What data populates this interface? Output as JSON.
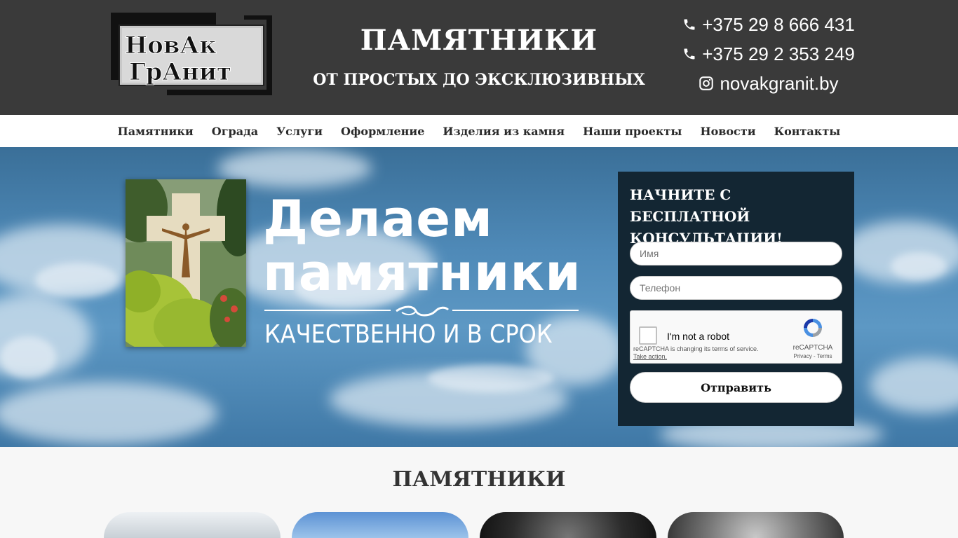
{
  "header": {
    "logo_line1": "НовАк",
    "logo_line2": "ГрАнит",
    "title": "ПАМЯТНИКИ",
    "subtitle": "ОТ ПРОСТЫХ ДО ЭКСКЛЮЗИВНЫХ",
    "phone1": "+375 29 8 666 431",
    "phone2": "+375 29 2 353 249",
    "instagram": "novakgranit.by"
  },
  "nav": {
    "items": [
      {
        "label": "Памятники"
      },
      {
        "label": "Ограда"
      },
      {
        "label": "Услуги"
      },
      {
        "label": "Оформление"
      },
      {
        "label": "Изделия из камня"
      },
      {
        "label": "Наши проекты"
      },
      {
        "label": "Новости"
      },
      {
        "label": "Контакты"
      }
    ]
  },
  "hero": {
    "title_line1": "Делаем",
    "title_line2": "памятники",
    "subtitle": "КАЧЕСТВЕННО И В СРОК"
  },
  "form": {
    "title": "НАЧНИТЕ С БЕСПЛАТНОЙ КОНСУЛЬТАЦИИ!",
    "name_placeholder": "Имя",
    "phone_placeholder": "Телефон",
    "captcha_label": "I'm not a robot",
    "captcha_note": "reCAPTCHA is changing its terms of service.",
    "captcha_note_link": "Take action.",
    "captcha_brand": "reCAPTCHA",
    "captcha_links": "Privacy - Terms",
    "submit_label": "Отправить"
  },
  "section": {
    "title": "ПАМЯТНИКИ"
  },
  "colors": {
    "header_bg": "#3a3a3a",
    "form_bg": "#132633",
    "hero_sky": "#4f8ab8"
  }
}
